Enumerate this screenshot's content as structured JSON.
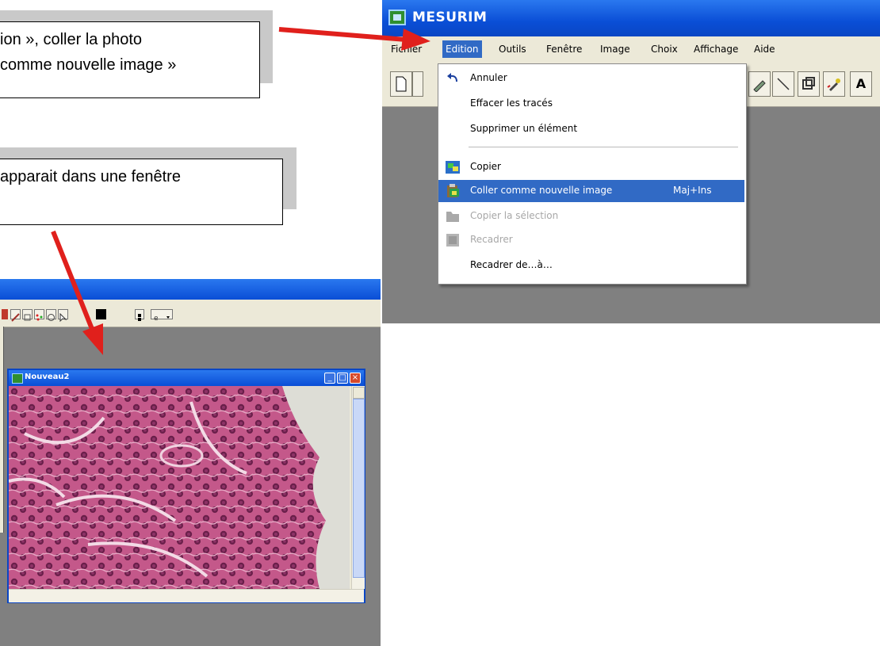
{
  "callouts": {
    "first": {
      "line1": "ion », coller la photo",
      "line2": "comme nouvelle image »"
    },
    "second": {
      "line1": "apparait dans une fenêtre"
    }
  },
  "mesurim": {
    "title": "MESURIM",
    "menu": [
      "Fichier",
      "Edition",
      "Outils",
      "Fenêtre",
      "Image",
      "Choix",
      "Affichage",
      "Aide"
    ],
    "active_menu": "Edition",
    "toolbar_trailing": "A"
  },
  "edition_menu": {
    "items": [
      {
        "label": "Annuler",
        "icon": "undo-icon",
        "shortcut": "",
        "state": "normal"
      },
      {
        "label": "Effacer les tracés",
        "icon": "",
        "shortcut": "",
        "state": "normal"
      },
      {
        "label": "Supprimer un élément",
        "icon": "",
        "shortcut": "",
        "state": "normal"
      },
      {
        "label": "Copier",
        "icon": "copy-icon",
        "shortcut": "",
        "state": "normal"
      },
      {
        "label": "Coller comme nouvelle image",
        "icon": "paste-image-icon",
        "shortcut": "Maj+Ins",
        "state": "highlighted"
      },
      {
        "label": "Copier la sélection",
        "icon": "copy-selection-icon",
        "shortcut": "",
        "state": "disabled"
      },
      {
        "label": "Recadrer",
        "icon": "crop-icon",
        "shortcut": "",
        "state": "disabled"
      },
      {
        "label": "Recadrer de…à…",
        "icon": "",
        "shortcut": "",
        "state": "normal"
      }
    ]
  },
  "child_window": {
    "title": "Nouveau2"
  },
  "colors": {
    "arrow": "#e0201c",
    "title_blue": "#0a4ed6",
    "highlight": "#316ac5",
    "workspace": "#808080"
  }
}
